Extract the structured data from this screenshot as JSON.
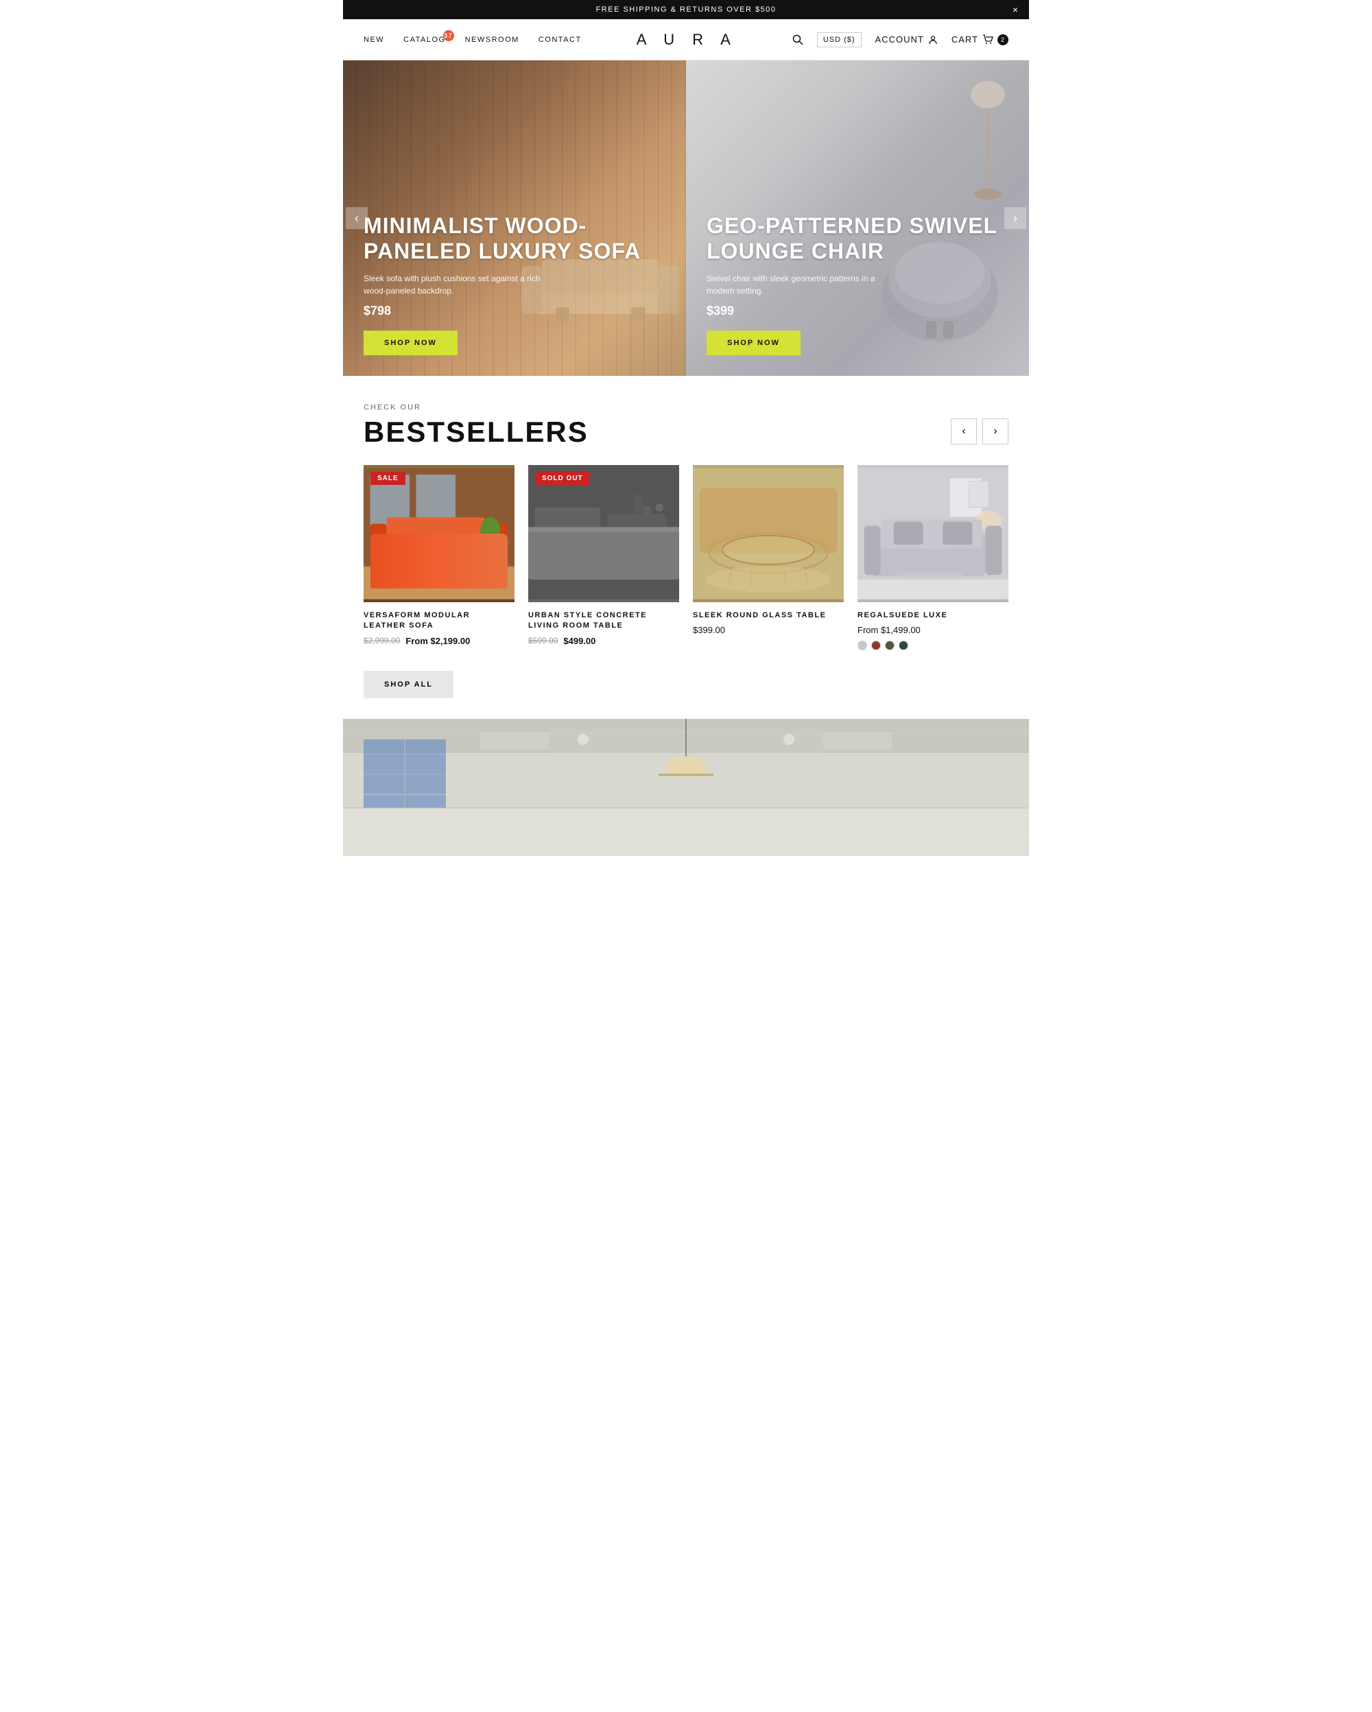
{
  "announcement": {
    "text": "FREE SHIPPING & RETURNS OVER $500",
    "close_label": "×"
  },
  "header": {
    "logo": "A U R A",
    "nav": [
      {
        "id": "new",
        "label": "NEW"
      },
      {
        "id": "catalog",
        "label": "CATALOG",
        "badge": "37"
      },
      {
        "id": "newsroom",
        "label": "NEWSROOM"
      },
      {
        "id": "contact",
        "label": "CONTACT"
      }
    ],
    "search_label": "🔍",
    "currency_label": "USD ($)",
    "account_label": "ACCOUNT",
    "cart_label": "CART",
    "cart_count": "2"
  },
  "hero": {
    "left": {
      "title": "MINIMALIST WOOD-PANELED LUXURY SOFA",
      "description": "Sleek sofa with plush cushions set against a rich wood-paneled backdrop.",
      "price": "$798",
      "btn_label": "SHOP NOW"
    },
    "right": {
      "title": "GEO-PATTERNED SWIVEL LOUNGE CHAIR",
      "description": "Swivel chair with sleek geometric patterns in a modern setting.",
      "price": "$399",
      "btn_label": "SHOP NOW"
    },
    "arrow_left": "‹",
    "arrow_right": "›"
  },
  "bestsellers": {
    "label": "CHECK OUR",
    "title": "BESTSELLERS",
    "arrow_prev": "‹",
    "arrow_next": "›",
    "products": [
      {
        "id": "versaform",
        "name": "VERSAFORM MODULAR LEATHER SOFA",
        "price_original": "$2,999.00",
        "price_sale": "From $2,199.00",
        "badge": "SALE",
        "badge_type": "sale",
        "img_type": "sofa"
      },
      {
        "id": "urban-concrete",
        "name": "URBAN STYLE CONCRETE LIVING ROOM TABLE",
        "price_original": "$599.00",
        "price_sale": "$499.00",
        "badge": "SOLD OUT",
        "badge_type": "sold-out",
        "img_type": "concrete"
      },
      {
        "id": "glass-table",
        "name": "SLEEK ROUND GLASS TABLE",
        "price": "$399.00",
        "badge": null,
        "img_type": "glass-table"
      },
      {
        "id": "regalsuede",
        "name": "REGALSUEDE LUXE",
        "price_from": "From $1,499.00",
        "badge": null,
        "img_type": "suede",
        "swatches": [
          "#c8c8c4",
          "#8b3a2a",
          "#4a5a3a",
          "#2a4a3a"
        ]
      }
    ],
    "shop_all_label": "SHOP ALL"
  }
}
